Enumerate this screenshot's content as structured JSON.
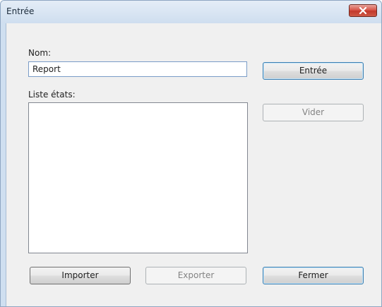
{
  "window": {
    "title": "Entrée"
  },
  "form": {
    "name_label": "Nom:",
    "name_value": "Report",
    "list_label": "Liste états:",
    "list_items": []
  },
  "buttons": {
    "enter": "Entrée",
    "clear": "Vider",
    "import": "Importer",
    "export": "Exporter",
    "close": "Fermer"
  },
  "colors": {
    "close_button": "#c7412f",
    "window_frame": "#cfdff0",
    "client_background": "#f0f0f0",
    "default_button_border": "#3c7fb1"
  },
  "icons": {
    "close": "close-icon"
  }
}
